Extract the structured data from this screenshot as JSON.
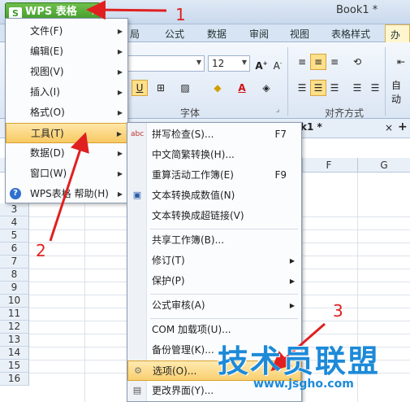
{
  "app": {
    "button_label": "WPS 表格",
    "logo_letter": "S",
    "doc_title": "Book1 *"
  },
  "ribbon_tabs": [
    "局",
    "公式",
    "数据",
    "审阅",
    "视图",
    "表格样式",
    "办公"
  ],
  "ribbon": {
    "font_size": "12",
    "font_group_label": "字体",
    "align_group_label": "对齐方式",
    "auto_wrap_label": "自动"
  },
  "sheet_tab": {
    "label": "k1 *",
    "close": "×",
    "add": "+"
  },
  "columns": [
    "F",
    "G"
  ],
  "rows": [
    "3",
    "4",
    "5",
    "6",
    "7",
    "8",
    "9",
    "10",
    "11",
    "12",
    "13",
    "14",
    "15",
    "16"
  ],
  "main_menu": {
    "items": [
      {
        "label": "文件(F)",
        "has_submenu": true
      },
      {
        "label": "编辑(E)",
        "has_submenu": true
      },
      {
        "label": "视图(V)",
        "has_submenu": true
      },
      {
        "label": "插入(I)",
        "has_submenu": true
      },
      {
        "label": "格式(O)",
        "has_submenu": true
      },
      {
        "label": "工具(T)",
        "has_submenu": true
      },
      {
        "label": "数据(D)",
        "has_submenu": true
      },
      {
        "label": "窗口(W)",
        "has_submenu": true
      },
      {
        "label": "WPS表格 帮助(H)",
        "has_submenu": true
      }
    ]
  },
  "tools_menu": {
    "items": [
      {
        "label": "拼写检查(S)...",
        "shortcut": "F7"
      },
      {
        "label": "中文简繁转换(H)...",
        "shortcut": ""
      },
      {
        "label": "重算活动工作簿(E)",
        "shortcut": "F9"
      },
      {
        "label": "文本转换成数值(N)",
        "shortcut": ""
      },
      {
        "label": "文本转换成超链接(V)",
        "shortcut": ""
      },
      {
        "label": "共享工作簿(B)...",
        "shortcut": ""
      },
      {
        "label": "修订(T)",
        "shortcut": ""
      },
      {
        "label": "保护(P)",
        "shortcut": ""
      },
      {
        "label": "公式审核(A)",
        "shortcut": ""
      },
      {
        "label": "COM 加载项(U)...",
        "shortcut": ""
      },
      {
        "label": "备份管理(K)...",
        "shortcut": ""
      },
      {
        "label": "选项(O)...",
        "shortcut": ""
      },
      {
        "label": "更改界面(Y)...",
        "shortcut": ""
      }
    ]
  },
  "annotations": [
    "1",
    "2",
    "3"
  ],
  "watermark": {
    "text": "技术员联盟",
    "url": "www.jsgho.com"
  },
  "colors": {
    "highlight": "#f8c962",
    "annotation_red": "#e02020",
    "wps_green": "#3f9a2a",
    "watermark_blue": "#1d8ad8"
  }
}
